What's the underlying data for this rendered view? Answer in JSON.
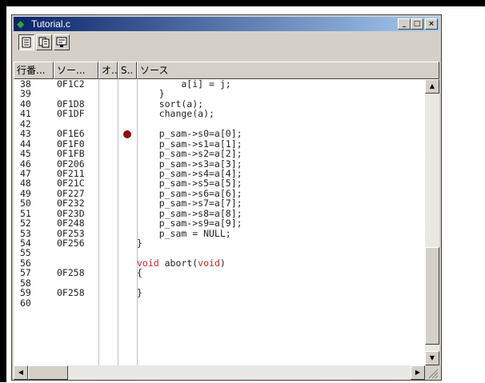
{
  "window": {
    "title": "Tutorial.c",
    "controls": {
      "minimize": "_",
      "maximize": "□",
      "close": "×"
    }
  },
  "toolbar": {
    "buttons": [
      {
        "name": "source-view",
        "pressed": true
      },
      {
        "name": "disassembly-view",
        "pressed": false
      },
      {
        "name": "mixed-view",
        "pressed": false
      }
    ]
  },
  "columns": {
    "line": "行番...",
    "address": "ソー...",
    "o": "オ..",
    "s": "S..",
    "source": "ソース"
  },
  "rows": [
    {
      "line": "38",
      "addr": "0F1C2",
      "src": "        a[i] = j;"
    },
    {
      "line": "39",
      "addr": "",
      "src": "    }"
    },
    {
      "line": "40",
      "addr": "0F1D8",
      "src": "    sort(a);"
    },
    {
      "line": "41",
      "addr": "0F1DF",
      "src": "    change(a);"
    },
    {
      "line": "42",
      "addr": "",
      "src": ""
    },
    {
      "line": "43",
      "addr": "0F1E6",
      "src": "    p_sam->s0=a[0];",
      "breakpoint": true
    },
    {
      "line": "44",
      "addr": "0F1F0",
      "src": "    p_sam->s1=a[1];"
    },
    {
      "line": "45",
      "addr": "0F1FB",
      "src": "    p_sam->s2=a[2];"
    },
    {
      "line": "46",
      "addr": "0F206",
      "src": "    p_sam->s3=a[3];"
    },
    {
      "line": "47",
      "addr": "0F211",
      "src": "    p_sam->s4=a[4];"
    },
    {
      "line": "48",
      "addr": "0F21C",
      "src": "    p_sam->s5=a[5];"
    },
    {
      "line": "49",
      "addr": "0F227",
      "src": "    p_sam->s6=a[6];"
    },
    {
      "line": "50",
      "addr": "0F232",
      "src": "    p_sam->s7=a[7];"
    },
    {
      "line": "51",
      "addr": "0F23D",
      "src": "    p_sam->s8=a[8];"
    },
    {
      "line": "52",
      "addr": "0F248",
      "src": "    p_sam->s9=a[9];"
    },
    {
      "line": "53",
      "addr": "0F253",
      "src": "    p_sam = NULL;"
    },
    {
      "line": "54",
      "addr": "0F256",
      "src": "}"
    },
    {
      "line": "55",
      "addr": "",
      "src": ""
    },
    {
      "line": "56",
      "addr": "",
      "src": "void abort(void)",
      "keyword_spans": [
        "void",
        "void"
      ]
    },
    {
      "line": "57",
      "addr": "0F258",
      "src": "{"
    },
    {
      "line": "58",
      "addr": "",
      "src": ""
    },
    {
      "line": "59",
      "addr": "0F258",
      "src": "}"
    },
    {
      "line": "60",
      "addr": "",
      "src": ""
    }
  ],
  "colors": {
    "breakpoint": "#8b1010",
    "keyword": "#cc2222",
    "titlebar_start": "#0a246a",
    "titlebar_end": "#a6caf0"
  },
  "scrollbars": {
    "up_arrow": "▲",
    "down_arrow": "▼",
    "left_arrow": "◀",
    "right_arrow": "▶"
  }
}
